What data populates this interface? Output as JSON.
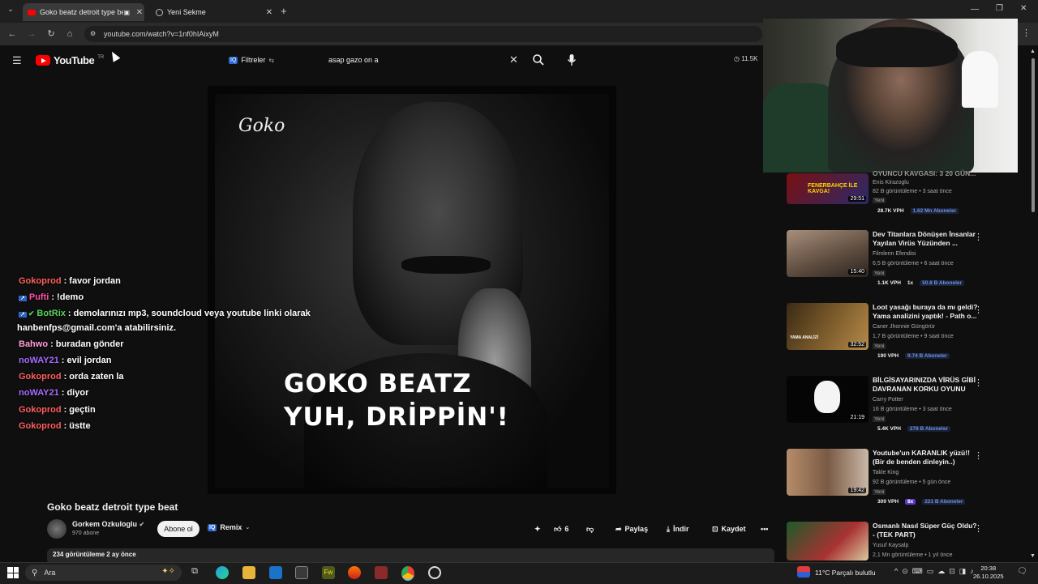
{
  "browser": {
    "tabs": [
      {
        "title": "Goko beatz detroit type be",
        "active": true
      },
      {
        "title": "Yeni Sekme",
        "active": false
      }
    ],
    "url": "youtube.com/watch?v=1nf0hIAixyM"
  },
  "youtube": {
    "logo_text": "YouTube",
    "country_code": "TR",
    "filters_label": "Filtreler",
    "filters_badge": "IQ",
    "search_value": "asap gazo on a",
    "vph_counter": "11.5K"
  },
  "video": {
    "cover_signature": "Goko",
    "cover_title_line1": "GOKO BEATZ",
    "cover_title_line2": "YUH, DRİPPİN'!",
    "title": "Goko beatz detroit type beat",
    "channel": "Gorkem Ozkuloglu",
    "subscribers": "970 abone",
    "subscribe_label": "Abone ol",
    "remix_label": "Remix",
    "likes": "6",
    "share_label": "Paylaş",
    "download_label": "İndir",
    "save_label": "Kaydet",
    "views_date": "234 görüntüleme  2 ay önce"
  },
  "chat": [
    {
      "user": "Gokoprod",
      "color": "#ff5f5f",
      "msg": ": favor jordan"
    },
    {
      "user": "Pufti",
      "color": "#ff4fa3",
      "msg": ": !demo"
    },
    {
      "user": "BotRix",
      "color": "#5ad35a",
      "msg": ": demolarınızı mp3, soundcloud veya youtube linki olarak"
    },
    {
      "user": "",
      "color": "#ffffff",
      "msg": "hanbenfps@gmail.com'a atabilirsiniz."
    },
    {
      "user": "Bahwo",
      "color": "#ff9fd6",
      "msg": ": buradan gönder"
    },
    {
      "user": "noWAY21",
      "color": "#a66bff",
      "msg": ": evil jordan"
    },
    {
      "user": "Gokoprod",
      "color": "#ff5f5f",
      "msg": ": orda zaten la"
    },
    {
      "user": "noWAY21",
      "color": "#a66bff",
      "msg": ": diyor"
    },
    {
      "user": "Gokoprod",
      "color": "#ff5f5f",
      "msg": ": geçtin"
    },
    {
      "user": "Gokoprod",
      "color": "#ff5f5f",
      "msg": ": üstte"
    }
  ],
  "recommendations": [
    {
      "title": "OYUNCU KAVGASI: 3 20 GÜN...",
      "channel": "Enis Kirazoglu",
      "stats": "82 B görüntüleme • 3 saat önce",
      "badge": "Yeni",
      "vph": "28.7K VPH",
      "extra": "",
      "subs": "1.62 Mn Aboneler",
      "duration": "29:51",
      "thumb_text": "FENERBAHÇE İLE KAVGA!"
    },
    {
      "title": "Dev Titanlara Dönüşen İnsanlar Yayılan Virüs Yüzünden ...",
      "channel": "Filmlerin Efendisi",
      "stats": "6,5 B görüntüleme • 6 saat önce",
      "badge": "Yeni",
      "vph": "1.1K VPH",
      "extra": "1x",
      "subs": "50.8 B Aboneler",
      "duration": "15:40",
      "thumb_text": ""
    },
    {
      "title": "Loot yasağı buraya da mı geldi? Yama analizini yaptık! - Path o...",
      "channel": "Caner Jhonnie Güngörür",
      "stats": "1,7 B görüntüleme • 9 saat önce",
      "badge": "Yeni",
      "vph": "190 VPH",
      "extra": "",
      "subs": "9.74 B Aboneler",
      "duration": "32:52",
      "thumb_text": "YAMA ANALİZİ"
    },
    {
      "title": "BİLGİSAYARINIZDA VİRÜS GİBİ DAVRANAN KORKU OYUNU",
      "channel": "Carry Potter",
      "stats": "16 B görüntüleme • 3 saat önce",
      "badge": "Yeni",
      "vph": "5.4K VPH",
      "extra": "",
      "subs": "278 B Aboneler",
      "duration": "21:19",
      "thumb_text": ""
    },
    {
      "title": "Youtube'un KARANLIK yüzü!! (Bir de benden dinleyin..)",
      "channel": "Takle King",
      "stats": "92 B görüntüleme • 5 gün önce",
      "badge": "Yeni",
      "vph": "309 VPH",
      "extra": "8x",
      "subs": "221 B Aboneler",
      "duration": "19:42",
      "thumb_text": ""
    },
    {
      "title": "Osmanlı Nasıl Süper Güç Oldu? - (TEK PART)",
      "channel": "Yusuf Kaysalp",
      "stats": "2,1 Mn görüntüleme • 1 yıl önce",
      "badge": "",
      "vph": "",
      "extra": "",
      "subs": "",
      "duration": "",
      "thumb_text": ""
    }
  ],
  "taskbar": {
    "search_placeholder": "Ara",
    "weather": "11°C  Parçalı bulutlu",
    "time": "20:38",
    "date": "26.10.2025"
  },
  "colors": {
    "yt_red": "#ff0000",
    "bg": "#0f0f0f",
    "link_blue": "#3ea6ff"
  }
}
